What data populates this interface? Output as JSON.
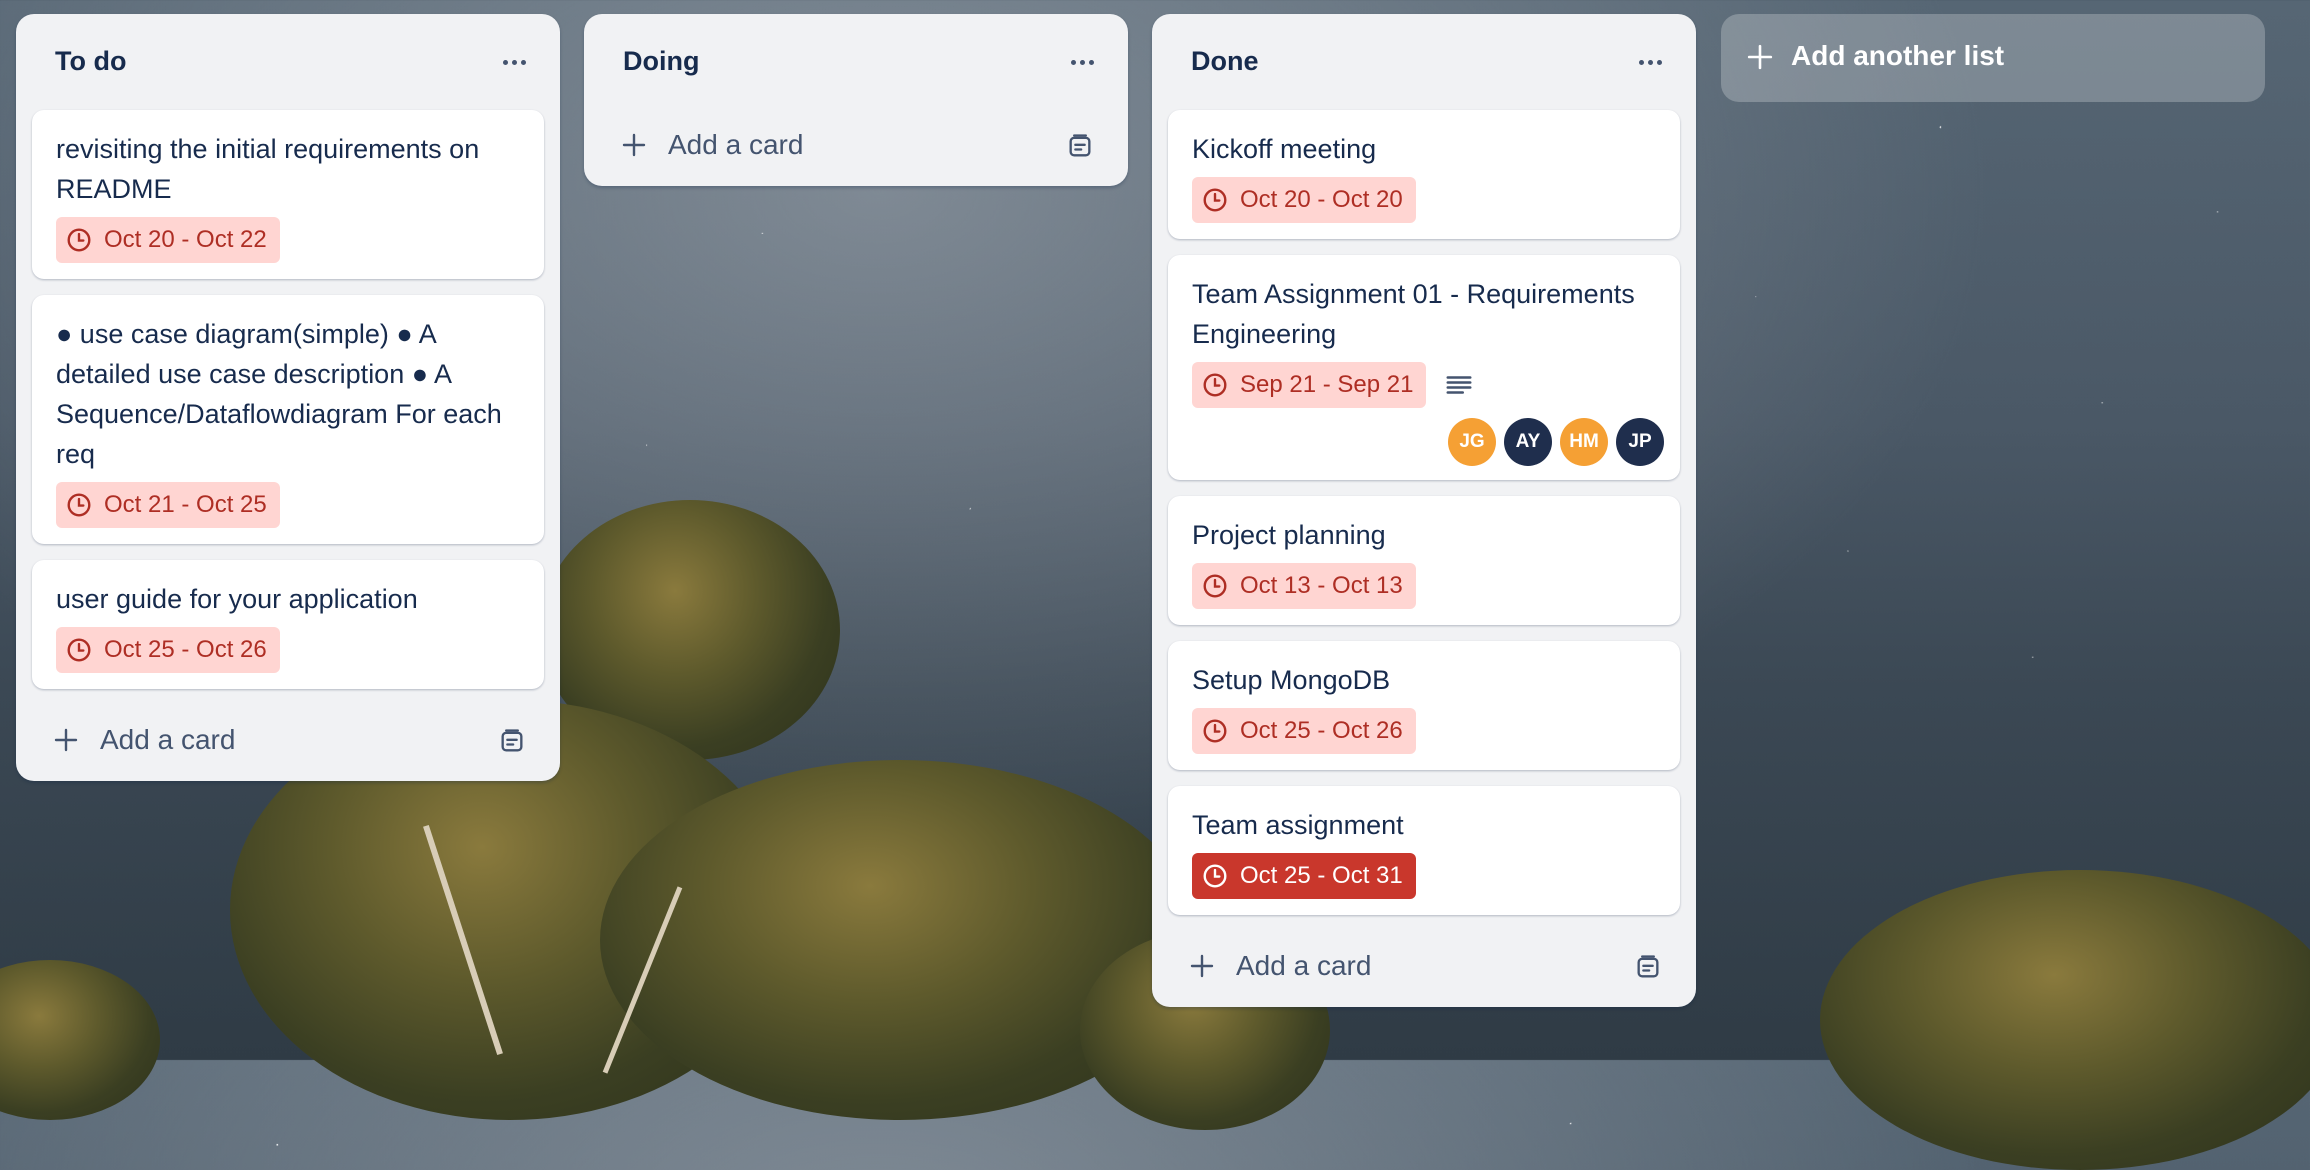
{
  "lists": [
    {
      "title": "To do",
      "cards": [
        {
          "title": "revisiting the initial requirements on README",
          "due": "Oct 20 - Oct 22"
        },
        {
          "title": "● use case diagram(simple) ● A detailed use case description ● A Sequence/Dataflowdiagram For each req",
          "due": "Oct 21 - Oct 25"
        },
        {
          "title": "user guide for your application",
          "due": "Oct 25 - Oct 26"
        }
      ],
      "add_card_label": "Add a card"
    },
    {
      "title": "Doing",
      "cards": [],
      "add_card_label": "Add a card"
    },
    {
      "title": "Done",
      "cards": [
        {
          "title": "Kickoff meeting",
          "due": "Oct 20 - Oct 20"
        },
        {
          "title": "Team Assignment 01 - Requirements Engineering",
          "due": "Sep 21 - Sep 21",
          "has_description": true,
          "members": [
            {
              "initials": "JG",
              "color": "#f5a034"
            },
            {
              "initials": "AY",
              "color": "#1f2e4d"
            },
            {
              "initials": "HM",
              "color": "#f5a034"
            },
            {
              "initials": "JP",
              "color": "#1f2e4d"
            }
          ]
        },
        {
          "title": "Project planning",
          "due": "Oct 13 - Oct 13"
        },
        {
          "title": "Setup MongoDB",
          "due": "Oct 25 - Oct 26"
        },
        {
          "title": "Team assignment",
          "due": "Oct 25 - Oct 31",
          "due_style": "strong"
        }
      ],
      "add_card_label": "Add a card"
    }
  ],
  "add_list_label": "Add another list",
  "icons": {
    "list_menu": "more-horizontal-icon",
    "due": "clock-icon",
    "description": "description-lines-icon",
    "add": "plus-icon",
    "template": "card-template-icon"
  },
  "colors": {
    "list_bg": "#f1f2f4",
    "due_bg": "#ffd5d2",
    "due_text": "#ae2e24",
    "due_strong_bg": "#c9372c"
  }
}
